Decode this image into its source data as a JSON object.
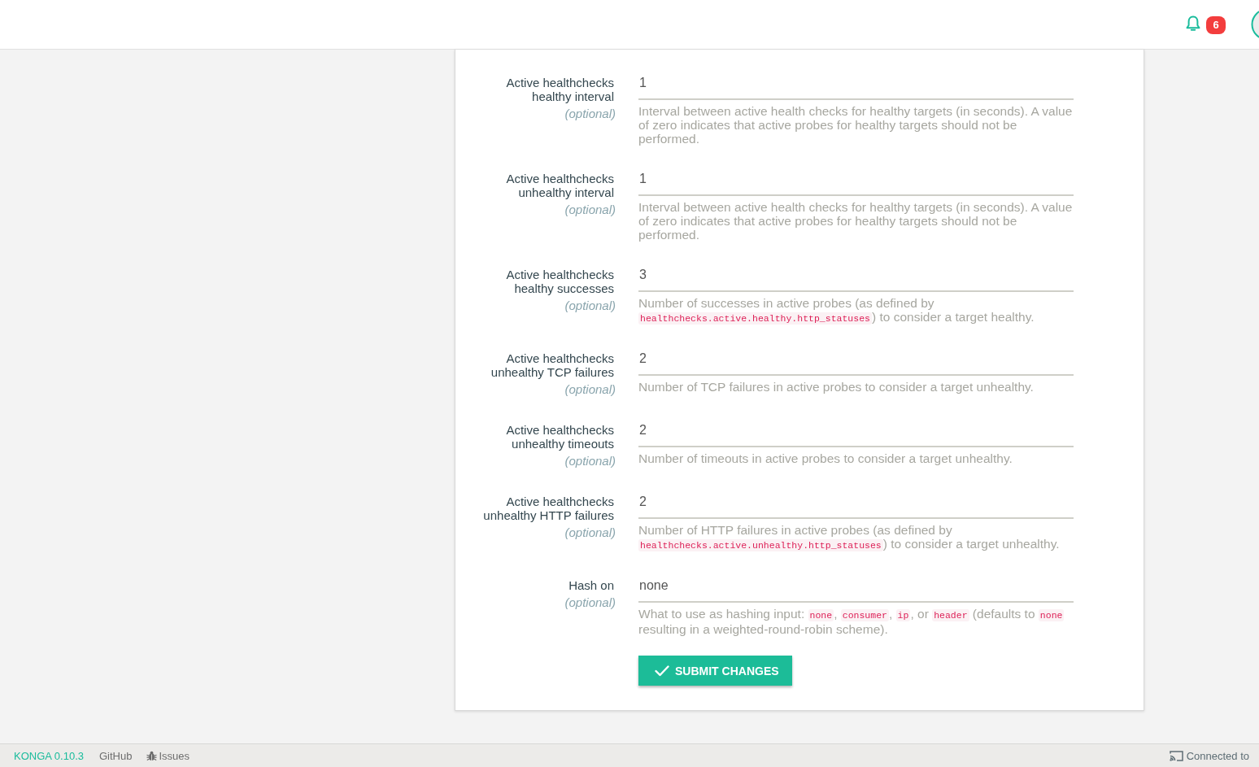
{
  "header": {
    "notification_count": "6"
  },
  "form": {
    "fields": [
      {
        "label": "Active healthchecks healthy interval",
        "note": "(optional)",
        "value": "1",
        "help": [
          {
            "kind": "text",
            "text": "Interval between active health checks for healthy targets (in seconds). A value of zero indicates that active probes for healthy targets should not be performed."
          }
        ]
      },
      {
        "label": "Active healthchecks unhealthy interval",
        "note": "(optional)",
        "value": "1",
        "help": [
          {
            "kind": "text",
            "text": "Interval between active health checks for healthy targets (in seconds). A value of zero indicates that active probes for healthy targets should not be performed."
          }
        ]
      },
      {
        "label": "Active healthchecks healthy successes",
        "note": "(optional)",
        "value": "3",
        "help": [
          {
            "kind": "text",
            "text": "Number of successes in active probes (as defined by "
          },
          {
            "kind": "code",
            "text": "healthchecks.active.healthy.http_statuses"
          },
          {
            "kind": "text",
            "text": ") to consider a target healthy."
          }
        ]
      },
      {
        "label": "Active healthchecks unhealthy TCP failures",
        "note": "(optional)",
        "value": "2",
        "help": [
          {
            "kind": "text",
            "text": "Number of TCP failures in active probes to consider a target unhealthy."
          }
        ]
      },
      {
        "label": "Active healthchecks unhealthy timeouts",
        "note": "(optional)",
        "value": "2",
        "help": [
          {
            "kind": "text",
            "text": "Number of timeouts in active probes to consider a target unhealthy."
          }
        ]
      },
      {
        "label": "Active healthchecks unhealthy HTTP failures",
        "note": "(optional)",
        "value": "2",
        "help": [
          {
            "kind": "text",
            "text": "Number of HTTP failures in active probes (as defined by "
          },
          {
            "kind": "code",
            "text": "healthchecks.active.unhealthy.http_statuses"
          },
          {
            "kind": "text",
            "text": ") to consider a target unhealthy."
          }
        ]
      },
      {
        "label": "Hash on",
        "note": "(optional)",
        "value": "none",
        "help": [
          {
            "kind": "text",
            "text": "What to use as hashing input: "
          },
          {
            "kind": "code",
            "text": "none"
          },
          {
            "kind": "text",
            "text": ", "
          },
          {
            "kind": "code",
            "text": "consumer"
          },
          {
            "kind": "text",
            "text": ", "
          },
          {
            "kind": "code",
            "text": "ip"
          },
          {
            "kind": "text",
            "text": ", or "
          },
          {
            "kind": "code",
            "text": "header"
          },
          {
            "kind": "text",
            "text": " (defaults to "
          },
          {
            "kind": "code",
            "text": "none"
          },
          {
            "kind": "text",
            "text": " resulting in a weighted-round-robin scheme)."
          }
        ]
      }
    ],
    "submit": {
      "label": "SUBMIT CHANGES"
    }
  },
  "footer": {
    "brand": "KONGA 0.10.3",
    "github": "GitHub",
    "issues": "Issues",
    "connection": "Connected to"
  }
}
